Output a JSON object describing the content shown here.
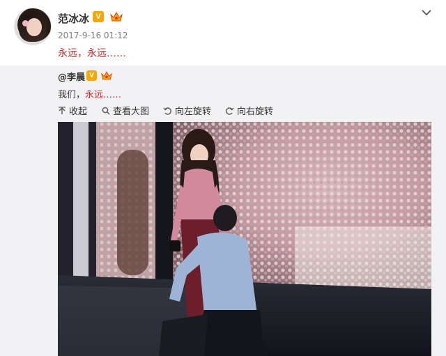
{
  "post": {
    "username": "范冰冰",
    "verified_badge": "V",
    "timestamp": "2017-9-16 01:12",
    "text": "永远，永远……"
  },
  "repost": {
    "username": "@李晨",
    "verified_badge": "V",
    "text_prefix": "我们，",
    "text_highlight": "永远……",
    "toolbar": {
      "collapse": "收起",
      "view_large": "查看大图",
      "rotate_left": "向左旋转",
      "rotate_right": "向右旋转"
    }
  },
  "colors": {
    "accent_red": "#d02b2b",
    "verified": "#f7a800",
    "repost_bg": "#f2f2f5",
    "meta_gray": "#808080"
  },
  "icons": [
    "chevron-down-icon",
    "collapse-arrow-icon",
    "search-icon",
    "rotate-left-icon",
    "rotate-right-icon",
    "crown-icon"
  ]
}
